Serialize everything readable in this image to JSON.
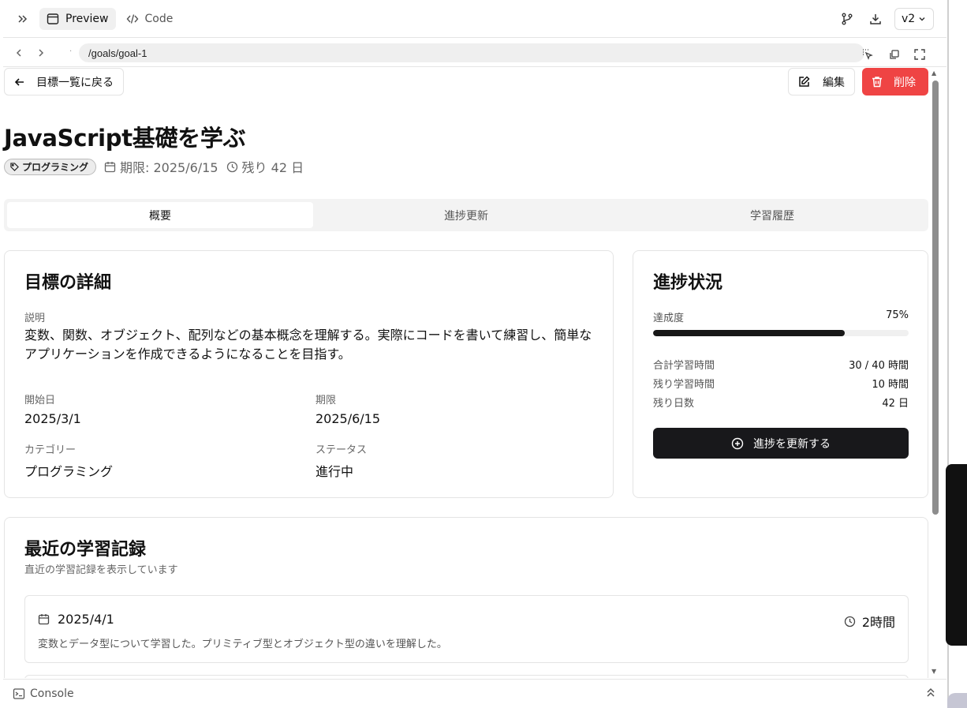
{
  "toolbar": {
    "preview_label": "Preview",
    "code_label": "Code",
    "version": "v2"
  },
  "address": {
    "url": "/goals/goal-1",
    "dot": "·"
  },
  "page": {
    "back_label": "目標一覧に戻る",
    "edit_label": "編集",
    "delete_label": "削除",
    "title": "JavaScript基礎を学ぶ",
    "category": "プログラミング",
    "deadline_meta": "期限: 2025/6/15",
    "remaining_meta": "残り 42 日",
    "tabs": [
      "概要",
      "進捗更新",
      "学習履歴"
    ],
    "active_tab": 0
  },
  "details": {
    "title": "目標の詳細",
    "description_label": "説明",
    "description": "変数、関数、オブジェクト、配列などの基本概念を理解する。実際にコードを書いて練習し、簡単なアプリケーションを作成できるようになることを目指す。",
    "start_label": "開始日",
    "start_value": "2025/3/1",
    "deadline_label": "期限",
    "deadline_value": "2025/6/15",
    "category_label": "カテゴリー",
    "category_value": "プログラミング",
    "status_label": "ステータス",
    "status_value": "進行中"
  },
  "progress": {
    "title": "進捗状況",
    "achievement_label": "達成度",
    "achievement_value": "75%",
    "achievement_fraction": 0.75,
    "total_hours_label": "合計学習時間",
    "total_hours_value": "30 / 40 時間",
    "remaining_hours_label": "残り学習時間",
    "remaining_hours_value": "10 時間",
    "remaining_days_label": "残り日数",
    "remaining_days_value": "42 日",
    "update_button": "進捗を更新する"
  },
  "records": {
    "title": "最近の学習記録",
    "subtitle": "直近の学習記録を表示しています",
    "items": [
      {
        "date": "2025/4/1",
        "duration": "2時間",
        "note": "変数とデータ型について学習した。プリミティブ型とオブジェクト型の違いを理解した。"
      }
    ]
  },
  "console": {
    "label": "Console"
  },
  "colors": {
    "danger": "#ef4444",
    "primary_dark": "#18181b",
    "progress_fill": "#171717"
  }
}
